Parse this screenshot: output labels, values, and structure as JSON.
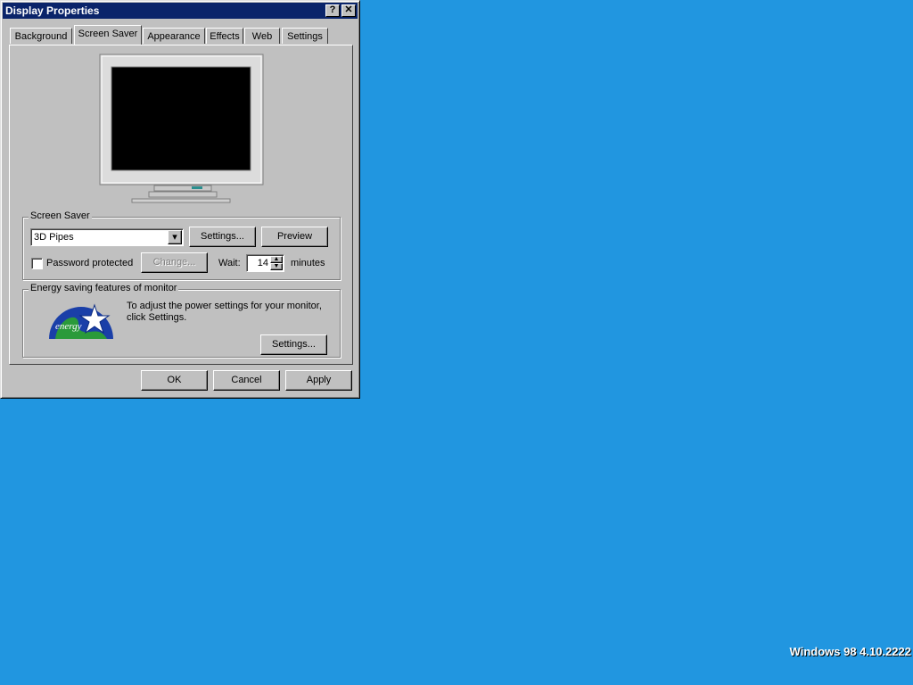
{
  "window": {
    "title": "Display Properties",
    "help_glyph": "?",
    "close_glyph": "✕"
  },
  "tabs": [
    {
      "label": "Background"
    },
    {
      "label": "Screen Saver"
    },
    {
      "label": "Appearance"
    },
    {
      "label": "Effects"
    },
    {
      "label": "Web"
    },
    {
      "label": "Settings"
    }
  ],
  "active_tab": "Screen Saver",
  "screen_saver": {
    "group_label": "Screen Saver",
    "selected": "3D Pipes",
    "settings_button": "Settings...",
    "preview_button": "Preview",
    "password_label": "Password protected",
    "password_checked": false,
    "change_button": "Change...",
    "wait_label": "Wait:",
    "wait_value": "14",
    "minutes_label": "minutes"
  },
  "energy": {
    "group_label": "Energy saving features of monitor",
    "text": "To adjust the power settings for your monitor, click Settings.",
    "settings_button": "Settings...",
    "logo_text": "energy"
  },
  "footer": {
    "ok": "OK",
    "cancel": "Cancel",
    "apply": "Apply"
  },
  "desktop": {
    "version": "Windows 98 4.10.2222"
  },
  "colors": {
    "desktop": "#2196e0",
    "titlebar": "#0a246a",
    "face": "#c0c0c0"
  }
}
